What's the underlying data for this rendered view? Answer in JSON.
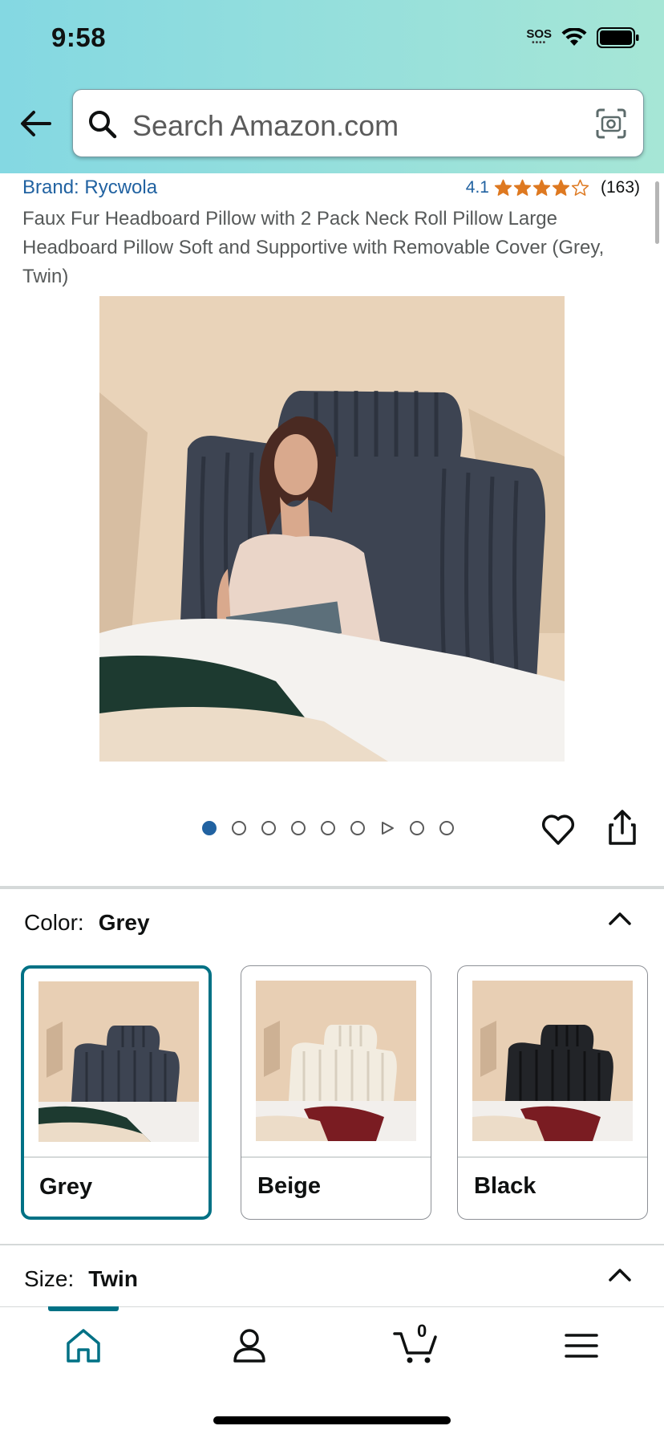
{
  "status_bar": {
    "time": "9:58",
    "sos": "SOS"
  },
  "search": {
    "placeholder": "Search Amazon.com"
  },
  "product": {
    "brand": "Brand: Rycwola",
    "rating": "4.1",
    "rating_value": 4.1,
    "rating_max": 5,
    "review_count": "(163)",
    "title": "Faux Fur Headboard Pillow with 2 Pack Neck Roll Pillow Large Headboard Pillow Soft and Supportive with Removable Cover (Grey, Twin)"
  },
  "gallery": {
    "image_count": 9,
    "active_index": 0,
    "video_index": 6
  },
  "color": {
    "label": "Color:",
    "selected": "Grey",
    "options": [
      {
        "name": "Grey",
        "selected": true
      },
      {
        "name": "Beige",
        "selected": false
      },
      {
        "name": "Black",
        "selected": false
      }
    ]
  },
  "size": {
    "label": "Size:",
    "selected": "Twin"
  },
  "tabbar": {
    "cart_count": "0",
    "active": "home"
  },
  "colors": {
    "accent": "#007185",
    "link": "#2162a1",
    "star": "#de7921",
    "header_gradient_start": "#84d8e2",
    "header_gradient_end": "#a6e6d6"
  }
}
